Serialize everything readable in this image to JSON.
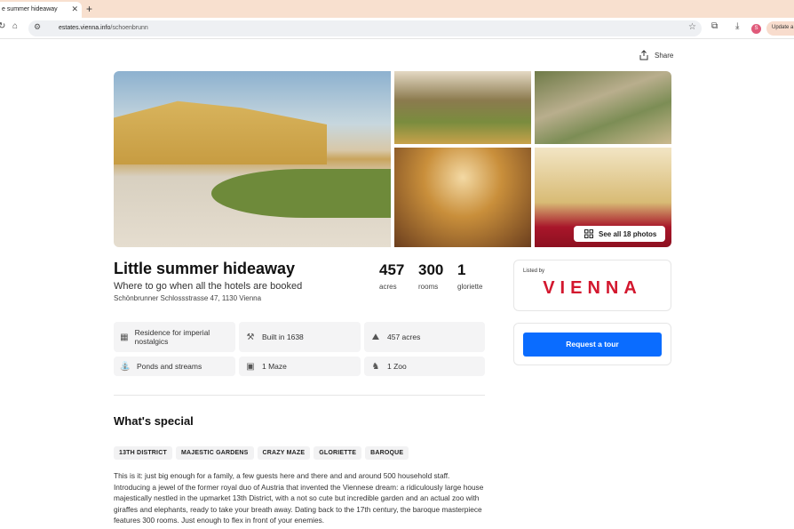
{
  "browser": {
    "tab_title": "e summer hideaway",
    "url_domain": "estates.vienna.info",
    "url_path": "/schoenbrunn",
    "update_label": "Update a",
    "avatar_letter": "S"
  },
  "header": {
    "share_label": "Share"
  },
  "gallery": {
    "see_all_label": "See all 18 photos"
  },
  "listing": {
    "title": "Little summer hideaway",
    "subtitle": "Where to go when all the hotels are booked",
    "address": "Schönbrunner Schlossstrasse 47, 1130 Vienna",
    "stats": [
      {
        "value": "457",
        "label": "acres"
      },
      {
        "value": "300",
        "label": "rooms"
      },
      {
        "value": "1",
        "label": "gloriette"
      }
    ],
    "features": [
      {
        "label": "Residence for imperial nostalgics",
        "icon": "building-icon"
      },
      {
        "label": "Built in 1638",
        "icon": "hammer-icon"
      },
      {
        "label": "457 acres",
        "icon": "area-icon"
      },
      {
        "label": "Ponds and streams",
        "icon": "fountain-icon"
      },
      {
        "label": "1 Maze",
        "icon": "maze-icon"
      },
      {
        "label": "1 Zoo",
        "icon": "elephant-icon"
      }
    ]
  },
  "special": {
    "title": "What's special",
    "tags": [
      "13TH DISTRICT",
      "MAJESTIC GARDENS",
      "CRAZY MAZE",
      "GLORIETTE",
      "BAROQUE"
    ],
    "description": "This is it: just big enough for a family, a few guests here and there and and around 500 household staff. Introducing a jewel of the former royal duo of Austria that invented the Viennese dream: a ridiculously large house majestically nestled in the upmarket 13th District, with a not so cute but incredible garden and an actual zoo with giraffes and elephants, ready to take your breath away. Dating back to the 17th century, the baroque masterpiece features 300 rooms. Just enough to flex in front of your enemies."
  },
  "sidebar": {
    "listed_by_label": "Listed by",
    "brand": "VIENNA",
    "tour_button": "Request a tour"
  },
  "colors": {
    "accent_blue": "#0a6cff",
    "brand_red": "#d3172e",
    "tabbar": "#f8e0cf"
  }
}
